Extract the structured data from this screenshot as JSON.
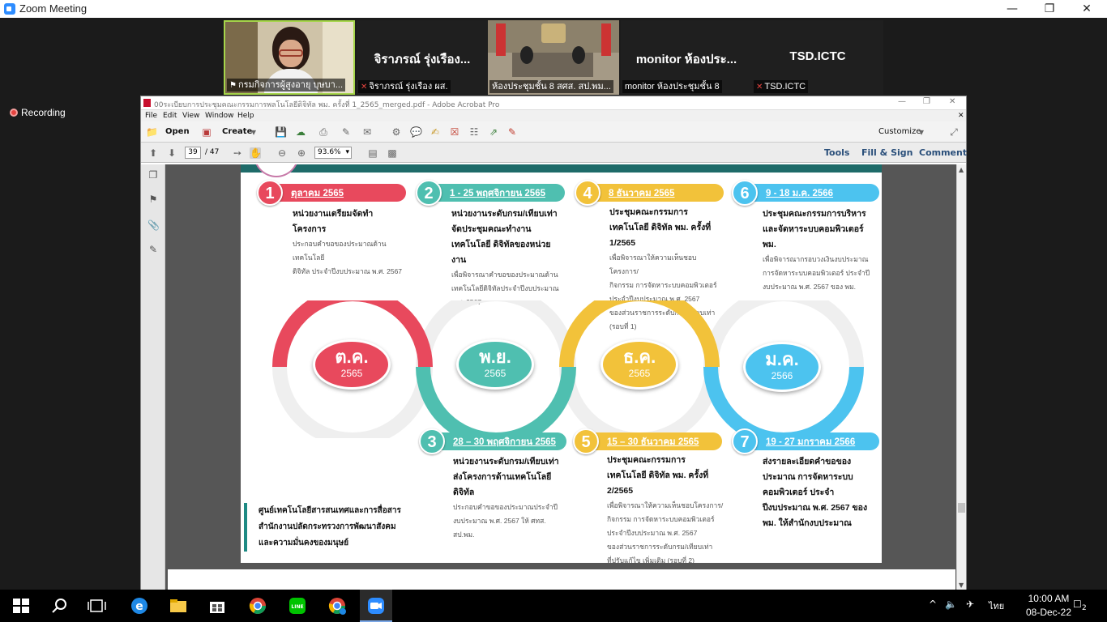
{
  "zoom": {
    "title": "Zoom Meeting",
    "recording_label": "Recording",
    "participants": [
      {
        "name": "กรมกิจการผู้สูงอายุ บุษบา...",
        "pinned": true,
        "muted": false,
        "video": true
      },
      {
        "name": "จิราภรณ์ รุ่งเรือง ผส.",
        "display": "จิราภรณ์ รุ่งเรือง...",
        "pinned": false,
        "muted": true,
        "video": false
      },
      {
        "name": "ห้องประชุมชั้น 8 สศส. สป.พม...",
        "pinned": false,
        "muted": false,
        "video": true
      },
      {
        "name": "monitor ห้องประชุมชั้น 8",
        "display": "monitor ห้องประ...",
        "pinned": false,
        "muted": false,
        "video": false
      },
      {
        "name": "TSD.ICTC",
        "display": "TSD.ICTC",
        "pinned": false,
        "muted": true,
        "video": false
      }
    ]
  },
  "acrobat": {
    "title": "00ระเบียบการประชุมคณะกรรมการพลโนโลยีดิจิทัล พม. ครั้งที่ 1_2565_merged.pdf - Adobe Acrobat Pro",
    "menu": [
      "File",
      "Edit",
      "View",
      "Window",
      "Help"
    ],
    "toolbar": {
      "open": "Open",
      "create": "Create",
      "customize": "Customize"
    },
    "nav": {
      "page": "39",
      "total": "/ 47",
      "zoom": "93.6%"
    },
    "right_links": [
      "Tools",
      "Fill & Sign",
      "Comment"
    ]
  },
  "slide": {
    "top_steps": [
      {
        "num": "1",
        "date": "ตุลาคม 2565",
        "color": "#e8495d",
        "heading": "หน่วยงานเตรียมจัดทำโครงการ",
        "sub": [
          "ประกอบคำขอของประมาณด้านเทคโนโลยี",
          "ดิจิทัล ประจำปีงบประมาณ พ.ศ. 2567"
        ]
      },
      {
        "num": "2",
        "date": "1 - 25 พฤศจิกายน 2565",
        "color": "#4fbfb0",
        "heading": "หน่วยงานระดับกรม/เทียบเท่า จัดประชุมคณะทำงานเทคโนโลยี ดิจิทัลของหน่วยงาน",
        "sub": [
          "เพื่อพิจารณาคำขอของประมาณด้าน",
          "เทคโนโลยีดิจิทัลประจำปีงบประมาณ",
          "พ.ศ. 2567"
        ]
      },
      {
        "num": "4",
        "date": "8 ธันวาคม 2565",
        "color": "#f2c23a",
        "heading": "ประชุมคณะกรรมการเทคโนโลยี ดิจิทัล พม. ครั้งที่ 1/2565",
        "sub": [
          "เพื่อพิจารณาให้ความเห็นชอบโครงการ/",
          "กิจกรรม การจัดหาระบบคอมพิวเตอร์",
          "ประจำปีงบประมาณ พ.ศ. 2567",
          "ของส่วนราชการระดับกรม/เทียบเท่า",
          "(รอบที่ 1)"
        ]
      },
      {
        "num": "6",
        "date": "9 - 18 ม.ค. 2566",
        "color": "#4cc3ef",
        "heading": "ประชุมคณะกรรมการบริหาร และจัดหาระบบคอมพิวเตอร์ พม.",
        "sub": [
          "เพื่อพิจารณากรอบวงเงินงบประมาณ",
          "การจัดหาระบบคอมพิวเตอร์ ประจำปี",
          "งบประมาณ พ.ศ. 2567 ของ พม."
        ]
      }
    ],
    "months": [
      {
        "label": "ต.ค.",
        "year": "2565",
        "color": "#e8495d"
      },
      {
        "label": "พ.ย.",
        "year": "2565",
        "color": "#4fbfb0"
      },
      {
        "label": "ธ.ค.",
        "year": "2565",
        "color": "#f2c23a"
      },
      {
        "label": "ม.ค.",
        "year": "2566",
        "color": "#4cc3ef"
      }
    ],
    "bottom_steps": [
      {
        "num": "3",
        "date": "28 – 30 พฤศจิกายน 2565",
        "color": "#4fbfb0",
        "heading": "หน่วยงานระดับกรม/เทียบเท่า ส่งโครงการด้านเทคโนโลยีดิจิทัล",
        "sub": [
          "ประกอบคำขอของประมาณประจำปี",
          "งบประมาณ พ.ศ. 2567 ให้ ศทส.",
          "สป.พม."
        ]
      },
      {
        "num": "5",
        "date": "15 – 30 ธันวาคม 2565",
        "color": "#f2c23a",
        "heading": "ประชุมคณะกรรมการเทคโนโลยี ดิจิทัล พม. ครั้งที่ 2/2565",
        "sub": [
          "เพื่อพิจารณาให้ความเห็นชอบโครงการ/",
          "กิจกรรม การจัดหาระบบคอมพิวเตอร์",
          "ประจำปีงบประมาณ พ.ศ. 2567",
          "ของส่วนราชการระดับกรม/เทียบเท่า",
          "ที่ปรับแก้ไข เพิ่มเติม (รอบที่ 2)"
        ]
      },
      {
        "num": "7",
        "date": "19 - 27 มกราคม 2566",
        "color": "#4cc3ef",
        "heading": "ส่งรายละเอียดคำขอของประมาณ การจัดหาระบบคอมพิวเตอร์ ประจำปีงบประมาณ พ.ศ. 2567 ของ พม. ให้สำนักงบประมาณ",
        "sub": []
      }
    ],
    "footer_org": [
      "ศูนย์เทคโนโลยีสารสนเทศและการสื่อสาร",
      "สำนักงานปลัดกระทรวงการพัฒนาสังคม",
      "และความมั่นคงของมนุษย์"
    ]
  },
  "taskbar": {
    "time": "10:00 AM",
    "date": "08-Dec-22",
    "lang": "ไทย",
    "notifications": "2"
  }
}
